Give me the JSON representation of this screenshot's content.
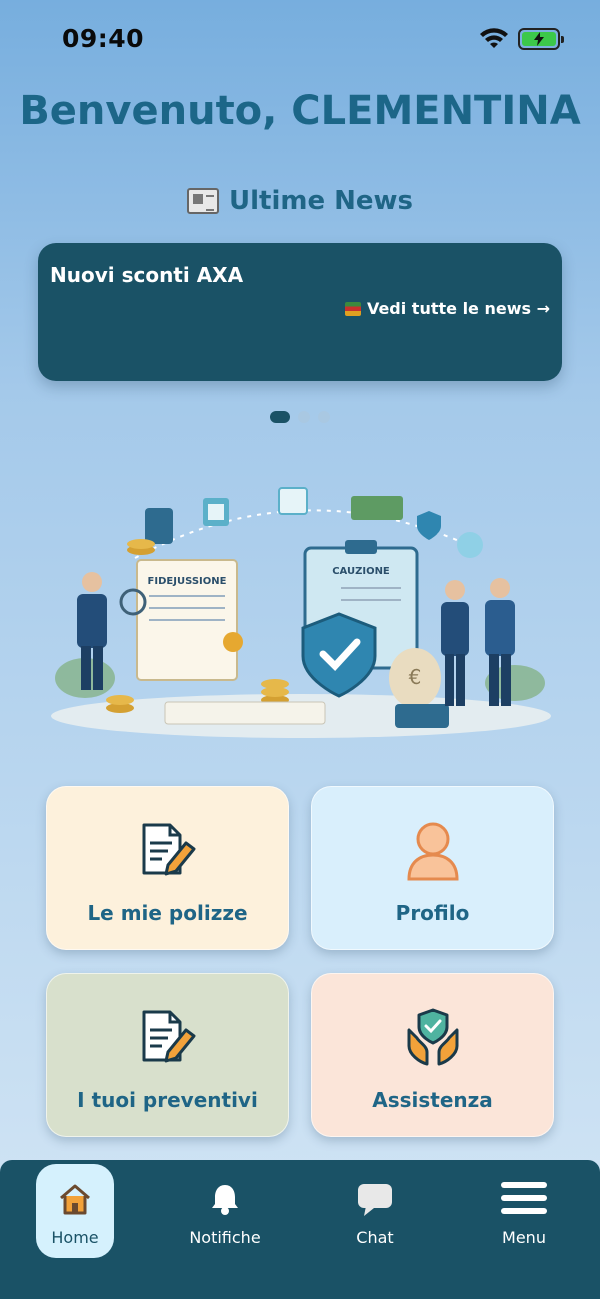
{
  "status_bar": {
    "time": "09:40"
  },
  "welcome": {
    "text": "Benvenuto, CLEMENTINA"
  },
  "news": {
    "heading": "Ultime News",
    "heading_icon": "newspaper-icon",
    "card": {
      "title": "Nuovi sconti AXA",
      "link_text": "Vedi tutte le news →",
      "link_icon": "books-icon"
    },
    "carousel": {
      "pages": 3,
      "active": 0
    }
  },
  "illustration": {
    "doc_left": "FIDEJUSSIONE",
    "doc_right": "CAUZIONE"
  },
  "tiles": [
    {
      "label": "Le mie polizze",
      "icon": "policy-document-icon",
      "color": "#fdf1dc"
    },
    {
      "label": "Profilo",
      "icon": "user-icon",
      "color": "#d9effc"
    },
    {
      "label": "I tuoi preventivi",
      "icon": "quote-document-icon",
      "color": "#d8e0cc"
    },
    {
      "label": "Assistenza",
      "icon": "shield-hands-icon",
      "color": "#fbe5d9"
    }
  ],
  "tabbar": {
    "items": [
      {
        "label": "Home",
        "icon": "home-icon",
        "active": true
      },
      {
        "label": "Notifiche",
        "icon": "bell-icon",
        "active": false
      },
      {
        "label": "Chat",
        "icon": "chat-icon",
        "active": false
      },
      {
        "label": "Menu",
        "icon": "menu-icon",
        "active": false
      }
    ]
  },
  "colors": {
    "primary": "#1a5266",
    "accent_text": "#1f6586",
    "active_tab": "#d5f1fd"
  }
}
